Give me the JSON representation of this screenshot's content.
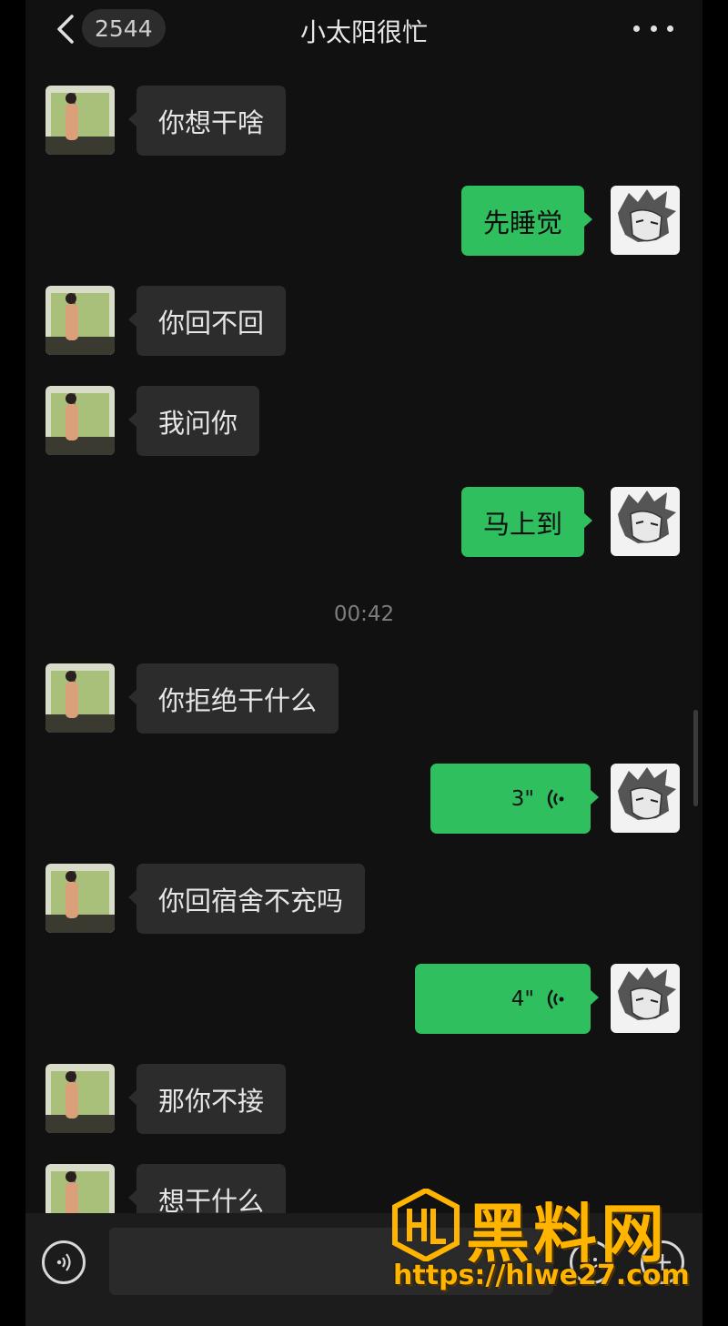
{
  "header": {
    "back_icon": "chevron-left-icon",
    "unread_count": "2544",
    "title": "小太阳很忙",
    "more_icon": "more-dots-icon"
  },
  "messages": [
    {
      "side": "in",
      "type": "text",
      "text": "你想干啥"
    },
    {
      "side": "out",
      "type": "text",
      "text": "先睡觉"
    },
    {
      "side": "in",
      "type": "text",
      "text": "你回不回"
    },
    {
      "side": "in",
      "type": "text",
      "text": "我问你"
    },
    {
      "side": "out",
      "type": "text",
      "text": "马上到"
    },
    {
      "side": "in",
      "type": "text",
      "text": "你拒绝干什么"
    },
    {
      "side": "out",
      "type": "voice",
      "text": "3\""
    },
    {
      "side": "in",
      "type": "text",
      "text": "你回宿舍不充吗"
    },
    {
      "side": "out",
      "type": "voice",
      "text": "4\""
    },
    {
      "side": "in",
      "type": "text",
      "text": "那你不接"
    },
    {
      "side": "in",
      "type": "text",
      "text": "想干什么"
    }
  ],
  "timestamp": "00:42",
  "input": {
    "voice_icon": "voice-input-icon",
    "placeholder": "",
    "emoji_icon": "emoji-icon",
    "add_icon": "plus-icon"
  },
  "watermark": {
    "text": "黑料网",
    "url": "https://hlwe27.com"
  },
  "colors": {
    "background": "#111111",
    "incoming_bubble": "#2c2c2c",
    "outgoing_bubble": "#2fbf5f",
    "watermark": "#ffb400"
  }
}
